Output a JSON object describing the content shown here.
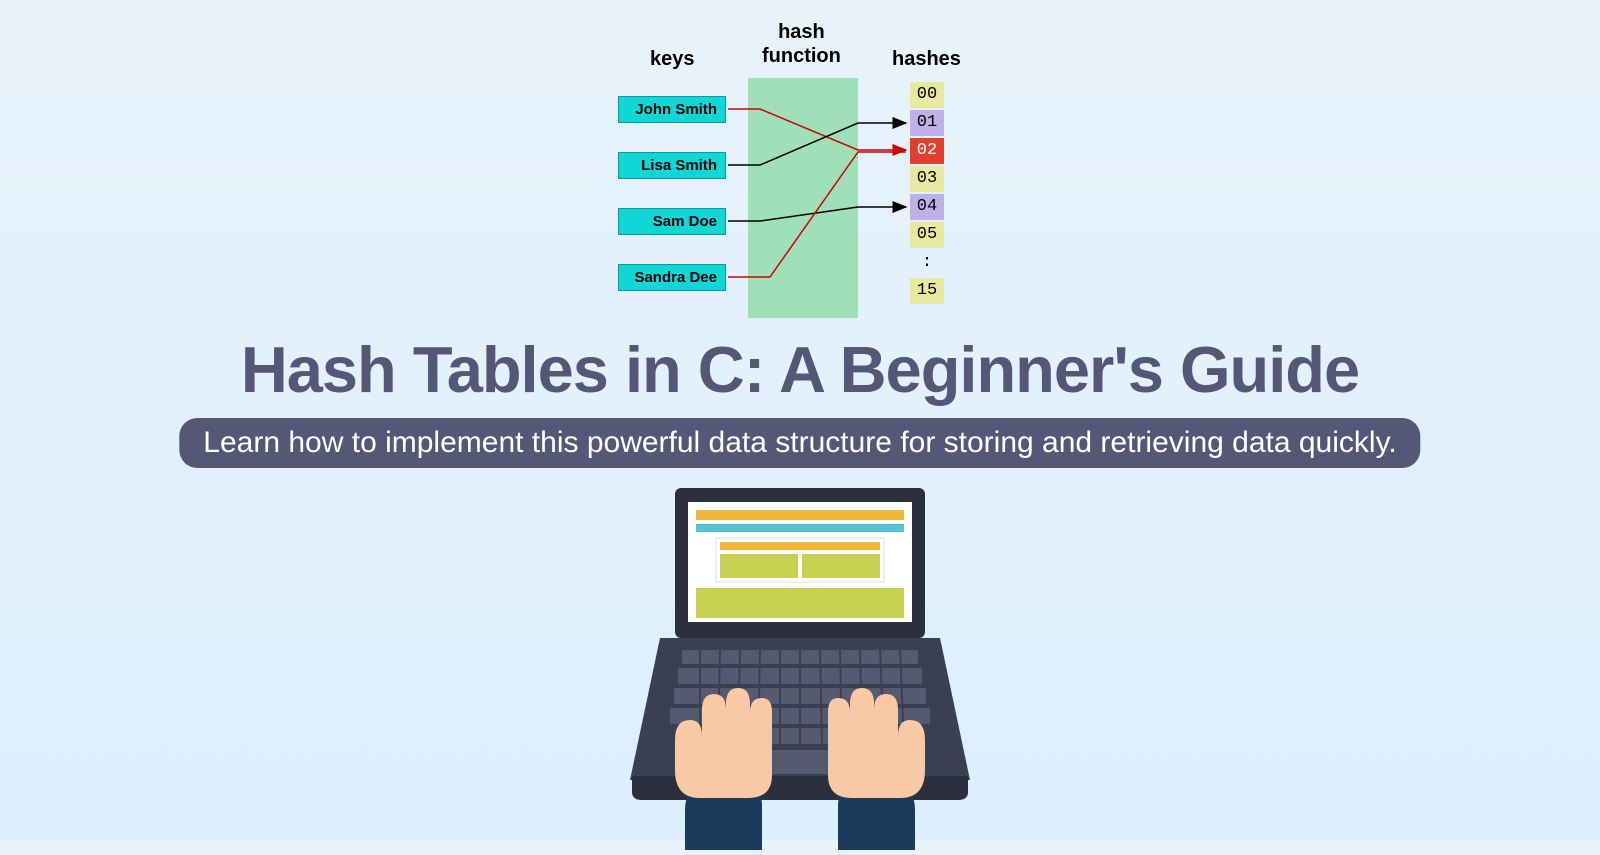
{
  "diagram": {
    "header_keys": "keys",
    "header_function": "hash\nfunction",
    "header_hashes": "hashes",
    "keys": [
      "John Smith",
      "Lisa Smith",
      "Sam Doe",
      "Sandra Dee"
    ],
    "hashes": [
      "00",
      "01",
      "02",
      "03",
      "04",
      "05",
      ":",
      "15"
    ]
  },
  "title": "Hash Tables in C: A Beginner's Guide",
  "subtitle": "Learn how to implement this powerful data structure for storing and retrieving data quickly."
}
